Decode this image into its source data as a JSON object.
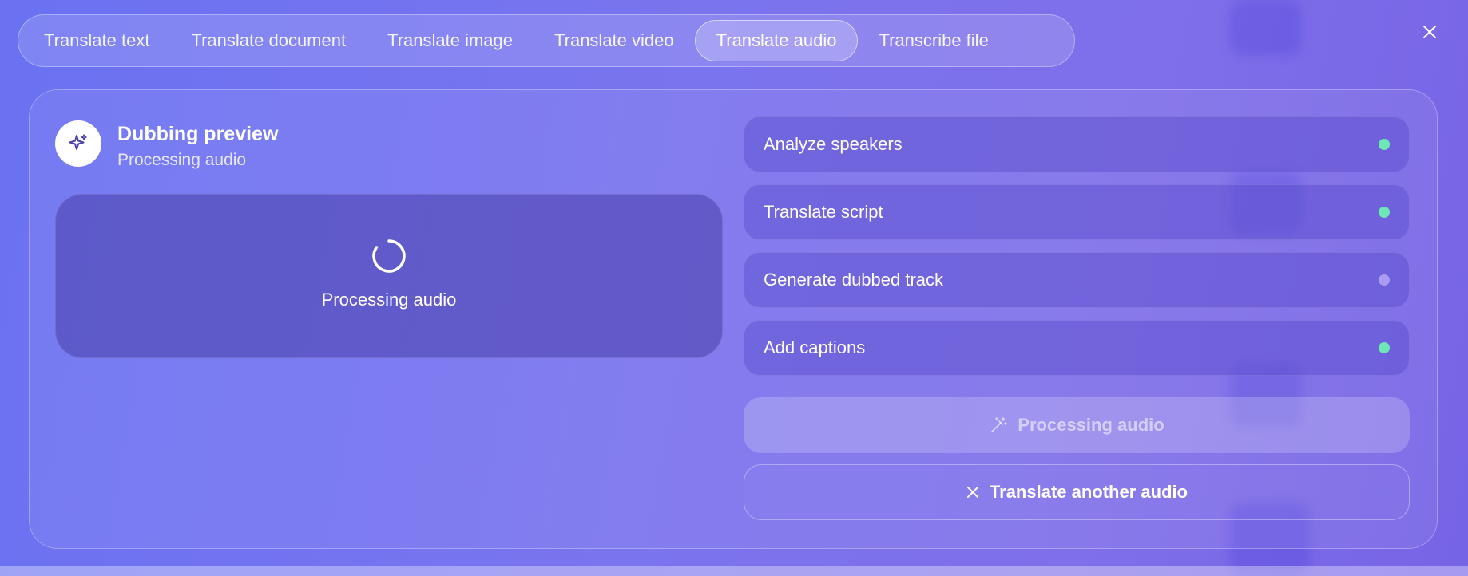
{
  "tabs": [
    {
      "label": "Translate text",
      "active": false
    },
    {
      "label": "Translate document",
      "active": false
    },
    {
      "label": "Translate image",
      "active": false
    },
    {
      "label": "Translate video",
      "active": false
    },
    {
      "label": "Translate audio",
      "active": true
    },
    {
      "label": "Transcribe file",
      "active": false
    }
  ],
  "header": {
    "icon": "sparkle-icon",
    "title": "Dubbing preview",
    "subtitle": "Processing audio"
  },
  "preview": {
    "icon": "spinner-icon",
    "label": "Processing audio"
  },
  "steps": [
    {
      "label": "Analyze speakers",
      "status_color": "#6ee7b7"
    },
    {
      "label": "Translate script",
      "status_color": "#6ee7b7"
    },
    {
      "label": "Generate dubbed track",
      "status_color": "#a99cf0"
    },
    {
      "label": "Add captions",
      "status_color": "#6ee7b7"
    }
  ],
  "actions": {
    "primary_label": "Processing audio",
    "primary_icon": "magic-wand-icon",
    "secondary_label": "Translate another audio",
    "secondary_icon": "close-icon"
  },
  "close_icon": "close-icon"
}
